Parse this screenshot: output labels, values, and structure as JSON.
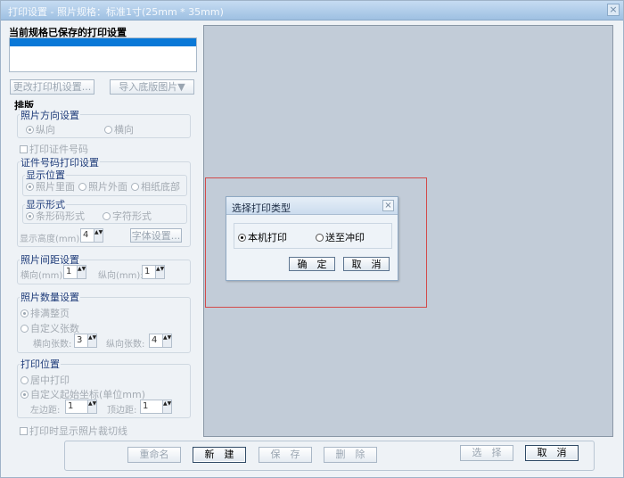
{
  "window": {
    "title": "打印设置 - 照片规格：标准1寸(25mm * 35mm)",
    "close_glyph": "×"
  },
  "saved_settings": {
    "heading": "当前规格已保存的打印设置"
  },
  "buttons": {
    "change_printer": "更改打印机设置...",
    "import_background": "导入底版图片▼",
    "font_settings": "字体设置...",
    "rename": "重命名",
    "new": "新　建",
    "save": "保　存",
    "delete": "删　除",
    "select": "选　择",
    "cancel": "取　消"
  },
  "layout_section": {
    "heading": "排版",
    "orientation": {
      "legend": "照片方向设置",
      "portrait": "纵向",
      "landscape": "横向"
    },
    "print_id_checkbox": "打印证件号码",
    "id_print_settings": {
      "legend": "证件号码打印设置",
      "position": {
        "legend": "显示位置",
        "inside": "照片里面",
        "outside": "照片外面",
        "paper_bottom": "相纸底部"
      },
      "form": {
        "legend": "显示形式",
        "barcode": "条形码形式",
        "text": "字符形式"
      },
      "height_label": "显示高度(mm):",
      "height_value": "4"
    },
    "spacing": {
      "legend": "照片间距设置",
      "h_label": "横向(mm):",
      "h_value": "1",
      "v_label": "纵向(mm):",
      "v_value": "1"
    },
    "quantity": {
      "legend": "照片数量设置",
      "fill_page": "排满整页",
      "custom": "自定义张数",
      "h_count_label": "横向张数:",
      "h_count_value": "3",
      "v_count_label": "纵向张数:",
      "v_count_value": "4"
    },
    "print_position": {
      "legend": "打印位置",
      "center": "居中打印",
      "custom_origin": "自定义起始坐标(单位mm)",
      "left_label": "左边距:",
      "left_value": "1",
      "top_label": "顶边距:",
      "top_value": "1"
    },
    "cut_lines_checkbox": "打印时显示照片裁切线"
  },
  "dialog": {
    "title": "选择打印类型",
    "close_glyph": "×",
    "local_print": "本机打印",
    "send_to_lab": "送至冲印",
    "ok": "确　定",
    "cancel": "取　消"
  },
  "spin_arrows": "▲▼"
}
